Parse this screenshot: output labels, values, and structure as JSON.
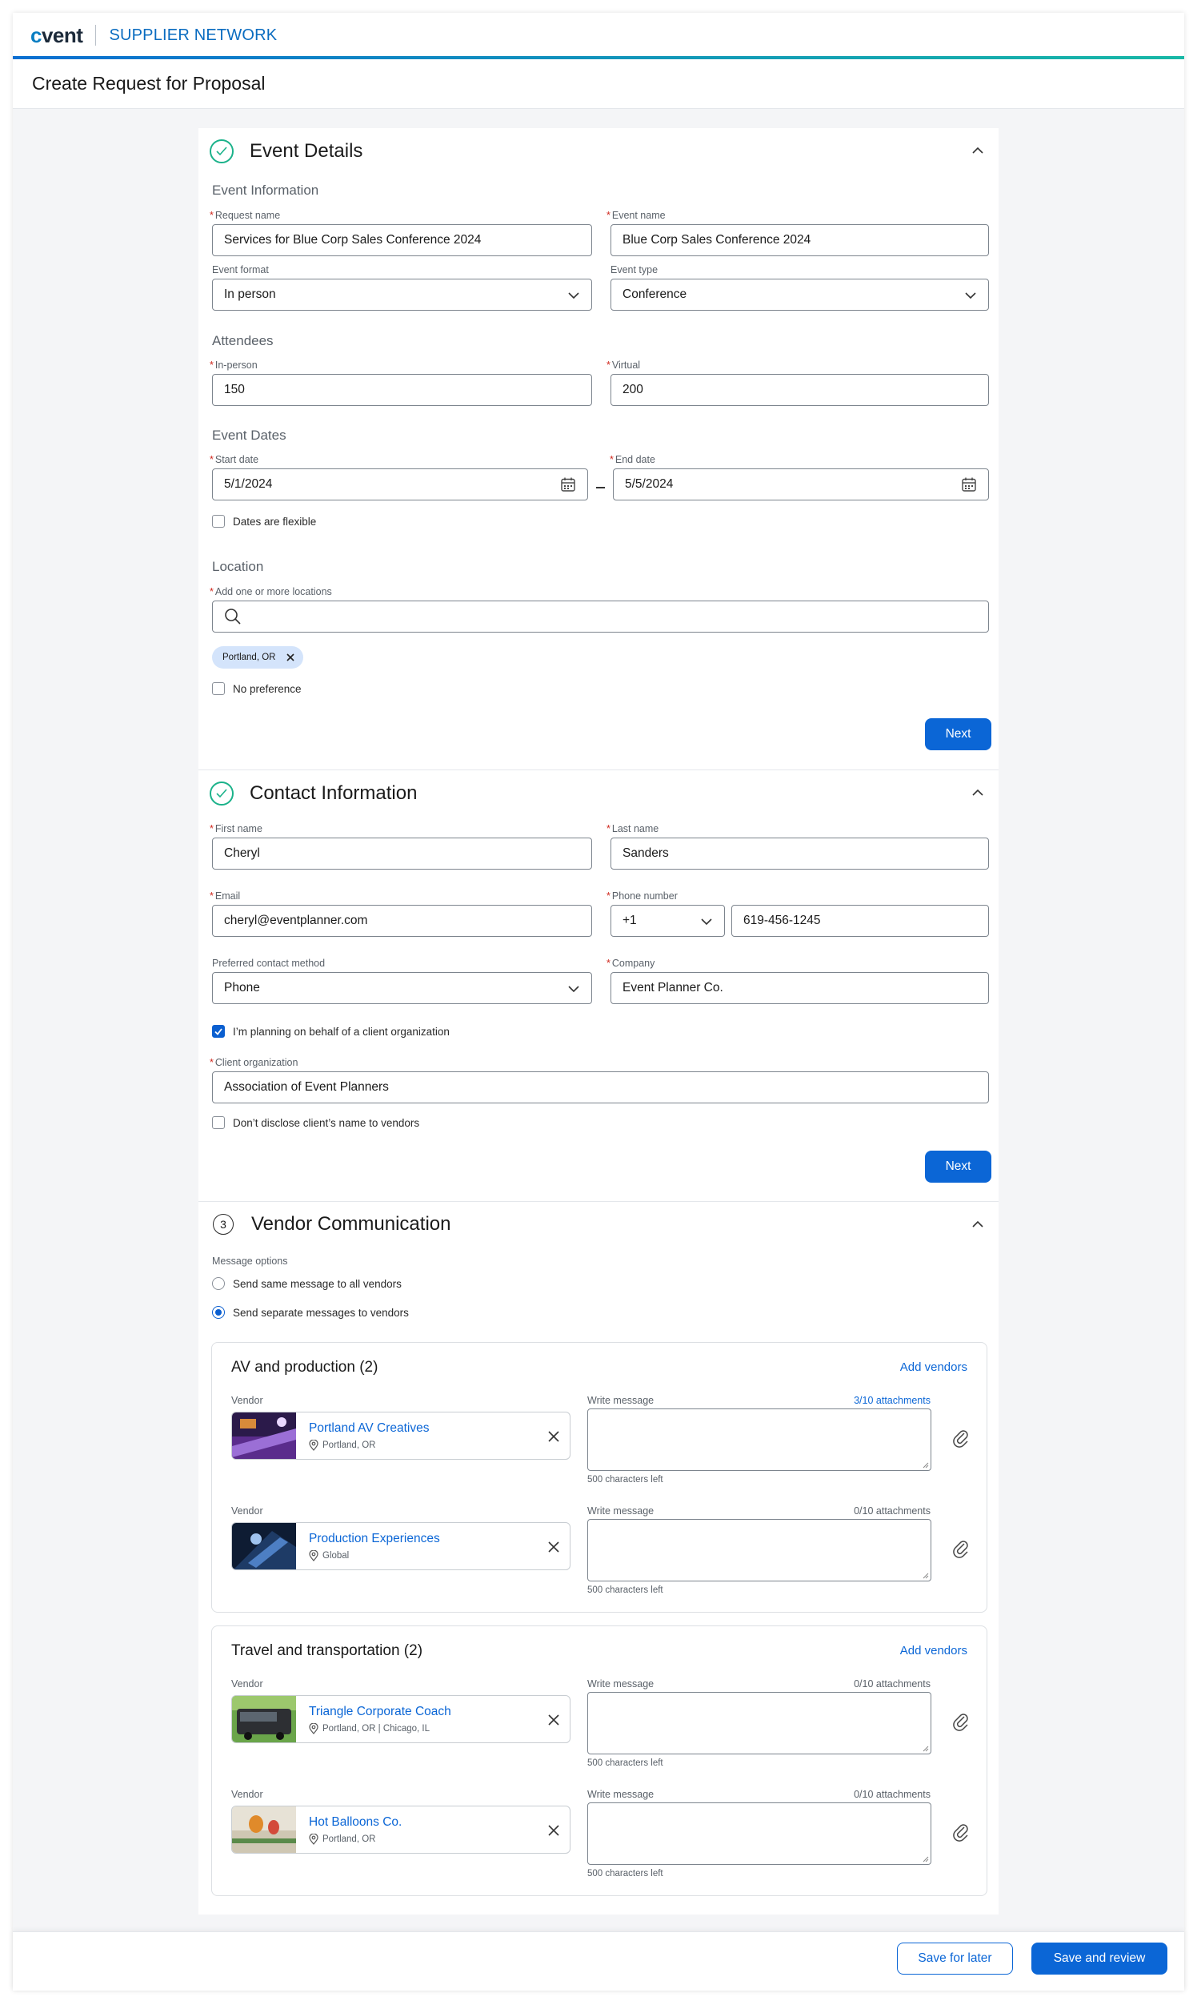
{
  "brand": {
    "logo_text": "cvent",
    "product": "SUPPLIER NETWORK"
  },
  "page_title": "Create Request for Proposal",
  "event_details": {
    "title": "Event Details",
    "info_heading": "Event Information",
    "request_name_label": "Request name",
    "request_name_value": "Services for Blue Corp Sales Conference 2024",
    "event_name_label": "Event name",
    "event_name_value": "Blue Corp Sales Conference 2024",
    "event_format_label": "Event format",
    "event_format_value": "In person",
    "event_type_label": "Event type",
    "event_type_value": "Conference",
    "attendees_heading": "Attendees",
    "in_person_label": "In-person",
    "in_person_value": "150",
    "virtual_label": "Virtual",
    "virtual_value": "200",
    "dates_heading": "Event Dates",
    "start_date_label": "Start date",
    "start_date_value": "5/1/2024",
    "end_date_label": "End date",
    "end_date_value": "5/5/2024",
    "flexible_label": "Dates are flexible",
    "location_heading": "Location",
    "location_label": "Add one or more locations",
    "location_chip": "Portland, OR",
    "no_preference_label": "No preference",
    "next_label": "Next"
  },
  "contact": {
    "title": "Contact Information",
    "first_name_label": "First name",
    "first_name_value": "Cheryl",
    "last_name_label": "Last name",
    "last_name_value": "Sanders",
    "email_label": "Email",
    "email_value": "cheryl@eventplanner.com",
    "phone_label": "Phone number",
    "phone_code": "+1",
    "phone_value": "619-456-1245",
    "preferred_label": "Preferred contact method",
    "preferred_value": "Phone",
    "company_label": "Company",
    "company_value": "Event Planner Co.",
    "behalf_label": "I’m planning on behalf of a client organization",
    "client_org_label": "Client organization",
    "client_org_value": "Association of Event Planners",
    "nondisclose_label": "Don’t disclose client’s name to vendors",
    "next_label": "Next"
  },
  "vendor_comm": {
    "step": "3",
    "title": "Vendor Communication",
    "message_options_label": "Message options",
    "option_same": "Send same message to all vendors",
    "option_separate": "Send separate messages to vendors",
    "vendor_label": "Vendor",
    "write_message_label": "Write message",
    "chars_left": "500 characters left",
    "add_vendors": "Add vendors",
    "groups": [
      {
        "title": "AV and production (2)",
        "vendors": [
          {
            "name": "Portland AV Creatives",
            "location": "Portland, OR",
            "attachments": "3/10 attachments"
          },
          {
            "name": "Production Experiences",
            "location": "Global",
            "attachments": "0/10 attachments"
          }
        ]
      },
      {
        "title": "Travel and transportation (2)",
        "vendors": [
          {
            "name": "Triangle Corporate Coach",
            "location": "Portland, OR | Chicago, IL",
            "attachments": "0/10 attachments"
          },
          {
            "name": "Hot Balloons Co.",
            "location": "Portland, OR",
            "attachments": "0/10 attachments"
          }
        ]
      }
    ]
  },
  "footer": {
    "save_later": "Save for later",
    "save_review": "Save and review"
  },
  "colors": {
    "accent": "#0b66d6",
    "success": "#1bb28a",
    "required": "#d0281e"
  }
}
